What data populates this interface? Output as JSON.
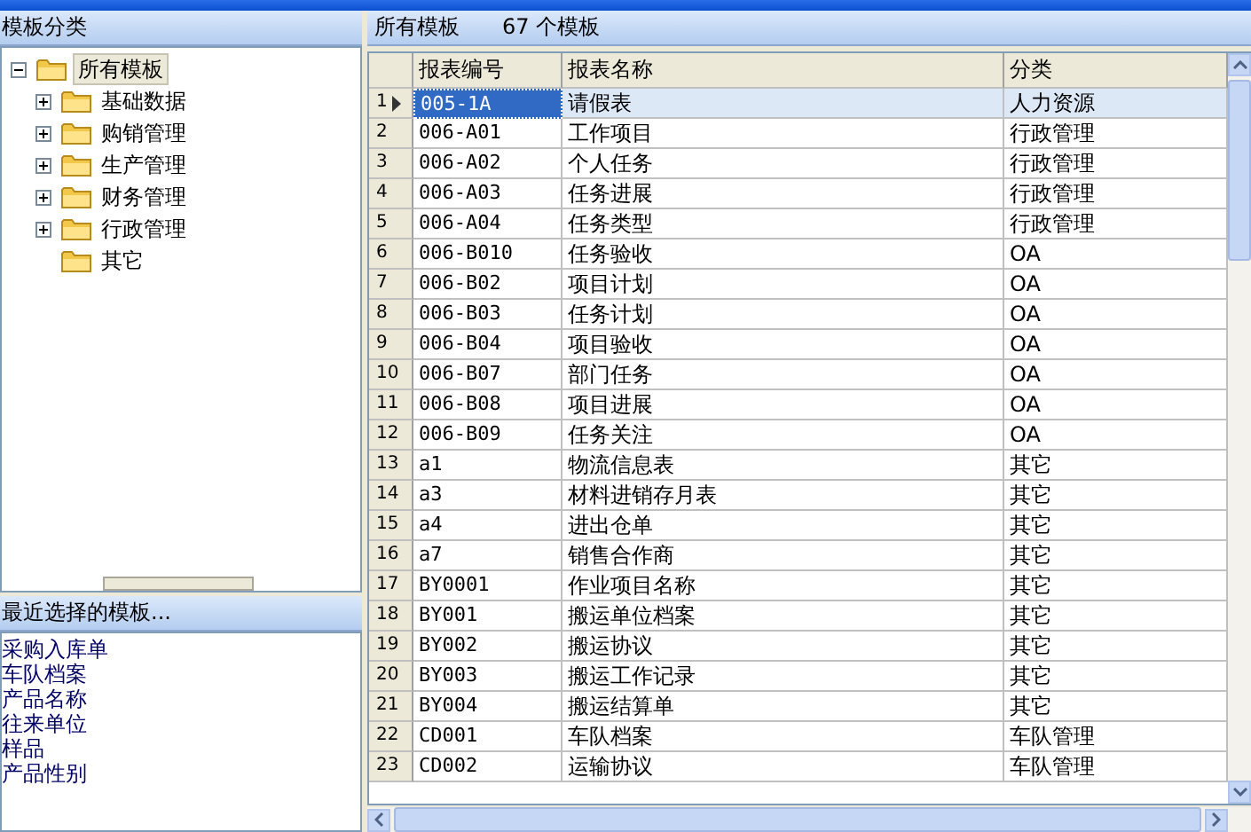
{
  "left_panel": {
    "title": "模板分类",
    "tree": [
      {
        "label": "所有模板",
        "selected": true,
        "expanded": true,
        "children": [
          {
            "label": "基础数据",
            "selected": false,
            "expanded": false
          },
          {
            "label": "购销管理",
            "selected": false,
            "expanded": false
          },
          {
            "label": "生产管理",
            "selected": false,
            "expanded": false
          },
          {
            "label": "财务管理",
            "selected": false,
            "expanded": false
          },
          {
            "label": "行政管理",
            "selected": false,
            "expanded": false
          },
          {
            "label": "其它",
            "selected": false
          }
        ]
      }
    ],
    "recent_title": "最近选择的模板...",
    "recent_items": [
      "采购入库单",
      "车队档案",
      "产品名称",
      "往来单位",
      "样品",
      "产品性别"
    ]
  },
  "right_panel": {
    "title": "所有模板",
    "count": "67 个模板",
    "table": {
      "columns": [
        "报表编号",
        "报表名称",
        "分类"
      ],
      "rows": [
        {
          "num": "1",
          "selected": true,
          "cells": [
            "005-1A",
            "请假表",
            "人力资源"
          ]
        },
        {
          "num": "2",
          "selected": false,
          "cells": [
            "006-A01",
            "工作项目",
            "行政管理"
          ]
        },
        {
          "num": "3",
          "selected": false,
          "cells": [
            "006-A02",
            "个人任务",
            "行政管理"
          ]
        },
        {
          "num": "4",
          "selected": false,
          "cells": [
            "006-A03",
            "任务进展",
            "行政管理"
          ]
        },
        {
          "num": "5",
          "selected": false,
          "cells": [
            "006-A04",
            "任务类型",
            "行政管理"
          ]
        },
        {
          "num": "6",
          "selected": false,
          "cells": [
            "006-B010",
            "任务验收",
            "OA"
          ]
        },
        {
          "num": "7",
          "selected": false,
          "cells": [
            "006-B02",
            "项目计划",
            "OA"
          ]
        },
        {
          "num": "8",
          "selected": false,
          "cells": [
            "006-B03",
            "任务计划",
            "OA"
          ]
        },
        {
          "num": "9",
          "selected": false,
          "cells": [
            "006-B04",
            "项目验收",
            "OA"
          ]
        },
        {
          "num": "10",
          "selected": false,
          "cells": [
            "006-B07",
            "部门任务",
            "OA"
          ]
        },
        {
          "num": "11",
          "selected": false,
          "cells": [
            "006-B08",
            "项目进展",
            "OA"
          ]
        },
        {
          "num": "12",
          "selected": false,
          "cells": [
            "006-B09",
            "任务关注",
            "OA"
          ]
        },
        {
          "num": "13",
          "selected": false,
          "cells": [
            "a1",
            "物流信息表",
            "其它"
          ]
        },
        {
          "num": "14",
          "selected": false,
          "cells": [
            "a3",
            "材料进销存月表",
            "其它"
          ]
        },
        {
          "num": "15",
          "selected": false,
          "cells": [
            "a4",
            "进出仓单",
            "其它"
          ]
        },
        {
          "num": "16",
          "selected": false,
          "cells": [
            "a7",
            "销售合作商",
            "其它"
          ]
        },
        {
          "num": "17",
          "selected": false,
          "cells": [
            "BY0001",
            "作业项目名称",
            "其它"
          ]
        },
        {
          "num": "18",
          "selected": false,
          "cells": [
            "BY001",
            "搬运单位档案",
            "其它"
          ]
        },
        {
          "num": "19",
          "selected": false,
          "cells": [
            "BY002",
            "搬运协议",
            "其它"
          ]
        },
        {
          "num": "20",
          "selected": false,
          "cells": [
            "BY003",
            "搬运工作记录",
            "其它"
          ]
        },
        {
          "num": "21",
          "selected": false,
          "cells": [
            "BY004",
            "搬运结算单",
            "其它"
          ]
        },
        {
          "num": "22",
          "selected": false,
          "cells": [
            "CD001",
            "车队档案",
            "车队管理"
          ]
        },
        {
          "num": "23",
          "selected": false,
          "cells": [
            "CD002",
            "运输协议",
            "车队管理"
          ]
        }
      ]
    }
  }
}
